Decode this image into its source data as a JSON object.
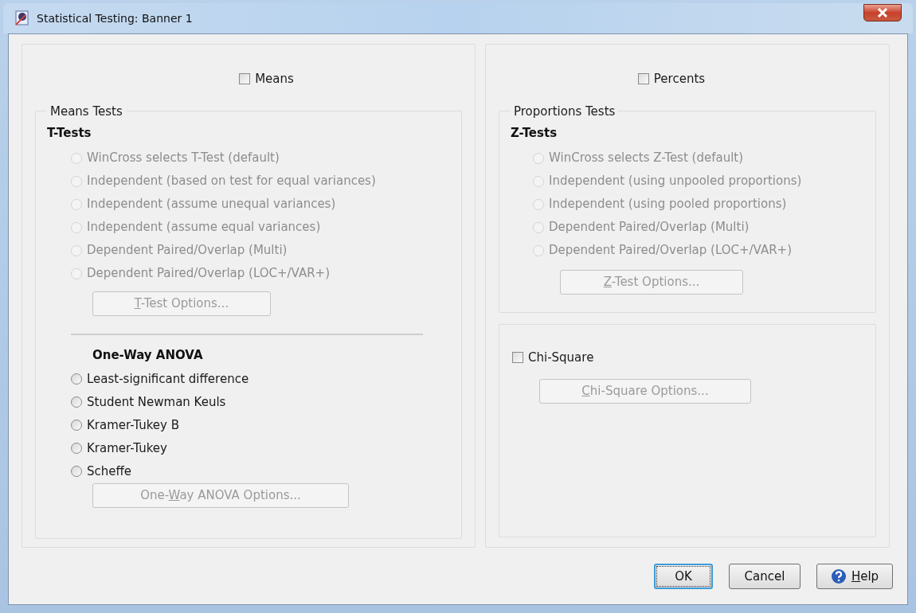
{
  "window": {
    "title": "Statistical Testing: Banner 1"
  },
  "means": {
    "checkbox": {
      "label": "Means",
      "checked": false
    },
    "group_title": "Means Tests",
    "t_tests": {
      "heading": "T-Tests",
      "options": [
        {
          "label": "WinCross selects T-Test (default)",
          "selected": false,
          "disabled": true
        },
        {
          "label": "Independent (based on test for equal variances)",
          "selected": false,
          "disabled": true
        },
        {
          "label": "Independent (assume unequal variances)",
          "selected": false,
          "disabled": true
        },
        {
          "label": "Independent (assume equal variances)",
          "selected": false,
          "disabled": true
        },
        {
          "label": "Dependent Paired/Overlap (Multi)",
          "selected": false,
          "disabled": true
        },
        {
          "label": "Dependent Paired/Overlap (LOC+/VAR+)",
          "selected": false,
          "disabled": true
        }
      ],
      "button": {
        "key": "T",
        "after": "-Test Options...",
        "disabled": true
      }
    },
    "anova": {
      "heading": "One-Way ANOVA",
      "options": [
        {
          "label": "Least-significant difference",
          "selected": false,
          "disabled": false
        },
        {
          "label": "Student Newman Keuls",
          "selected": false,
          "disabled": false
        },
        {
          "label": "Kramer-Tukey B",
          "selected": false,
          "disabled": false
        },
        {
          "label": "Kramer-Tukey",
          "selected": false,
          "disabled": false
        },
        {
          "label": "Scheffe",
          "selected": false,
          "disabled": false
        }
      ],
      "button": {
        "before": "One-",
        "key": "W",
        "after": "ay ANOVA Options...",
        "disabled": true
      }
    }
  },
  "percents": {
    "checkbox": {
      "label": "Percents",
      "checked": false
    },
    "group_title": "Proportions Tests",
    "z_tests": {
      "heading": "Z-Tests",
      "options": [
        {
          "label": "WinCross selects Z-Test (default)",
          "selected": false,
          "disabled": true
        },
        {
          "label": "Independent (using unpooled proportions)",
          "selected": false,
          "disabled": true
        },
        {
          "label": "Independent (using pooled proportions)",
          "selected": false,
          "disabled": true
        },
        {
          "label": "Dependent Paired/Overlap (Multi)",
          "selected": false,
          "disabled": true
        },
        {
          "label": "Dependent Paired/Overlap (LOC+/VAR+)",
          "selected": false,
          "disabled": true
        }
      ],
      "button": {
        "key": "Z",
        "after": "-Test Options...",
        "disabled": true
      }
    }
  },
  "chi_square": {
    "checkbox": {
      "label": "Chi-Square",
      "checked": false
    },
    "button": {
      "key": "C",
      "after": "hi-Square Options...",
      "disabled": true
    }
  },
  "buttons": [
    {
      "kind": "default",
      "after": "OK"
    },
    {
      "kind": "plain",
      "after": "Cancel"
    },
    {
      "kind": "help",
      "key": "H",
      "after": "elp"
    }
  ]
}
